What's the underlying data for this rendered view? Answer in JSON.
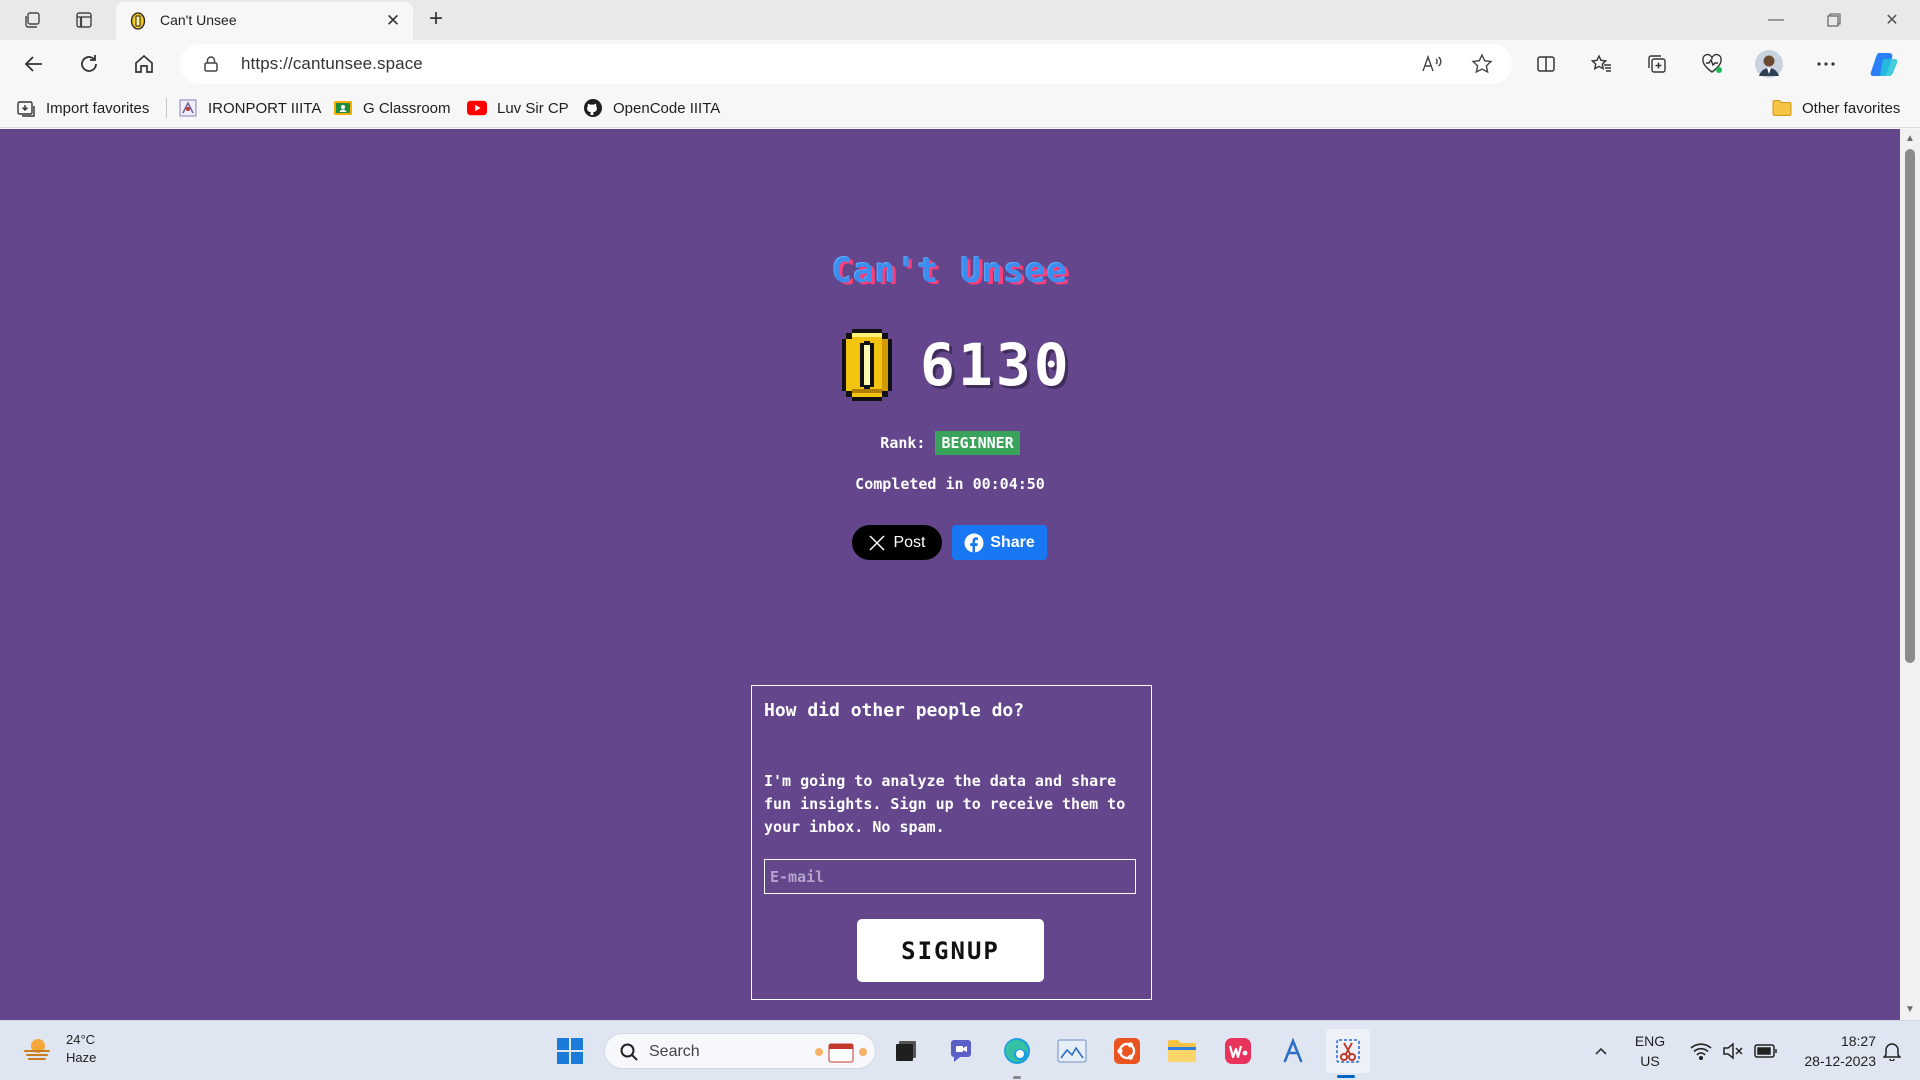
{
  "browser": {
    "tab": {
      "title": "Can't Unsee",
      "favicon": "coin-icon"
    },
    "address": {
      "url": "https://cantunsee.space"
    },
    "favorites": [
      {
        "label": "Import favorites",
        "icon": "import-icon"
      },
      {
        "label": "IRONPORT IIITA",
        "icon": "ironport-icon"
      },
      {
        "label": "G Classroom",
        "icon": "classroom-icon"
      },
      {
        "label": "Luv Sir CP",
        "icon": "youtube-icon"
      },
      {
        "label": "OpenCode IIITA",
        "icon": "github-icon"
      }
    ],
    "other_favorites": "Other favorites"
  },
  "page": {
    "title": "Can't Unsee",
    "score": "6130",
    "rank_label": "Rank:",
    "rank_value": "BEGINNER",
    "completed": "Completed in 00:04:50",
    "share_x": "Post",
    "share_fb": "Share",
    "signup": {
      "heading": "How did other people do?",
      "text": "I'm going to analyze the data and share fun insights. Sign up to receive them to your inbox. No spam.",
      "email_placeholder": "E-mail",
      "email_value": "",
      "button": "SIGNUP"
    },
    "colors": {
      "background": "#63468c",
      "rank_badge": "#3aa35b",
      "facebook": "#1877f2",
      "title": "#3c8df0"
    }
  },
  "taskbar": {
    "weather": {
      "temp": "24°C",
      "condition": "Haze"
    },
    "search_label": "Search",
    "language": {
      "lang": "ENG",
      "region": "US"
    },
    "clock": {
      "time": "18:27",
      "date": "28-12-2023"
    }
  }
}
